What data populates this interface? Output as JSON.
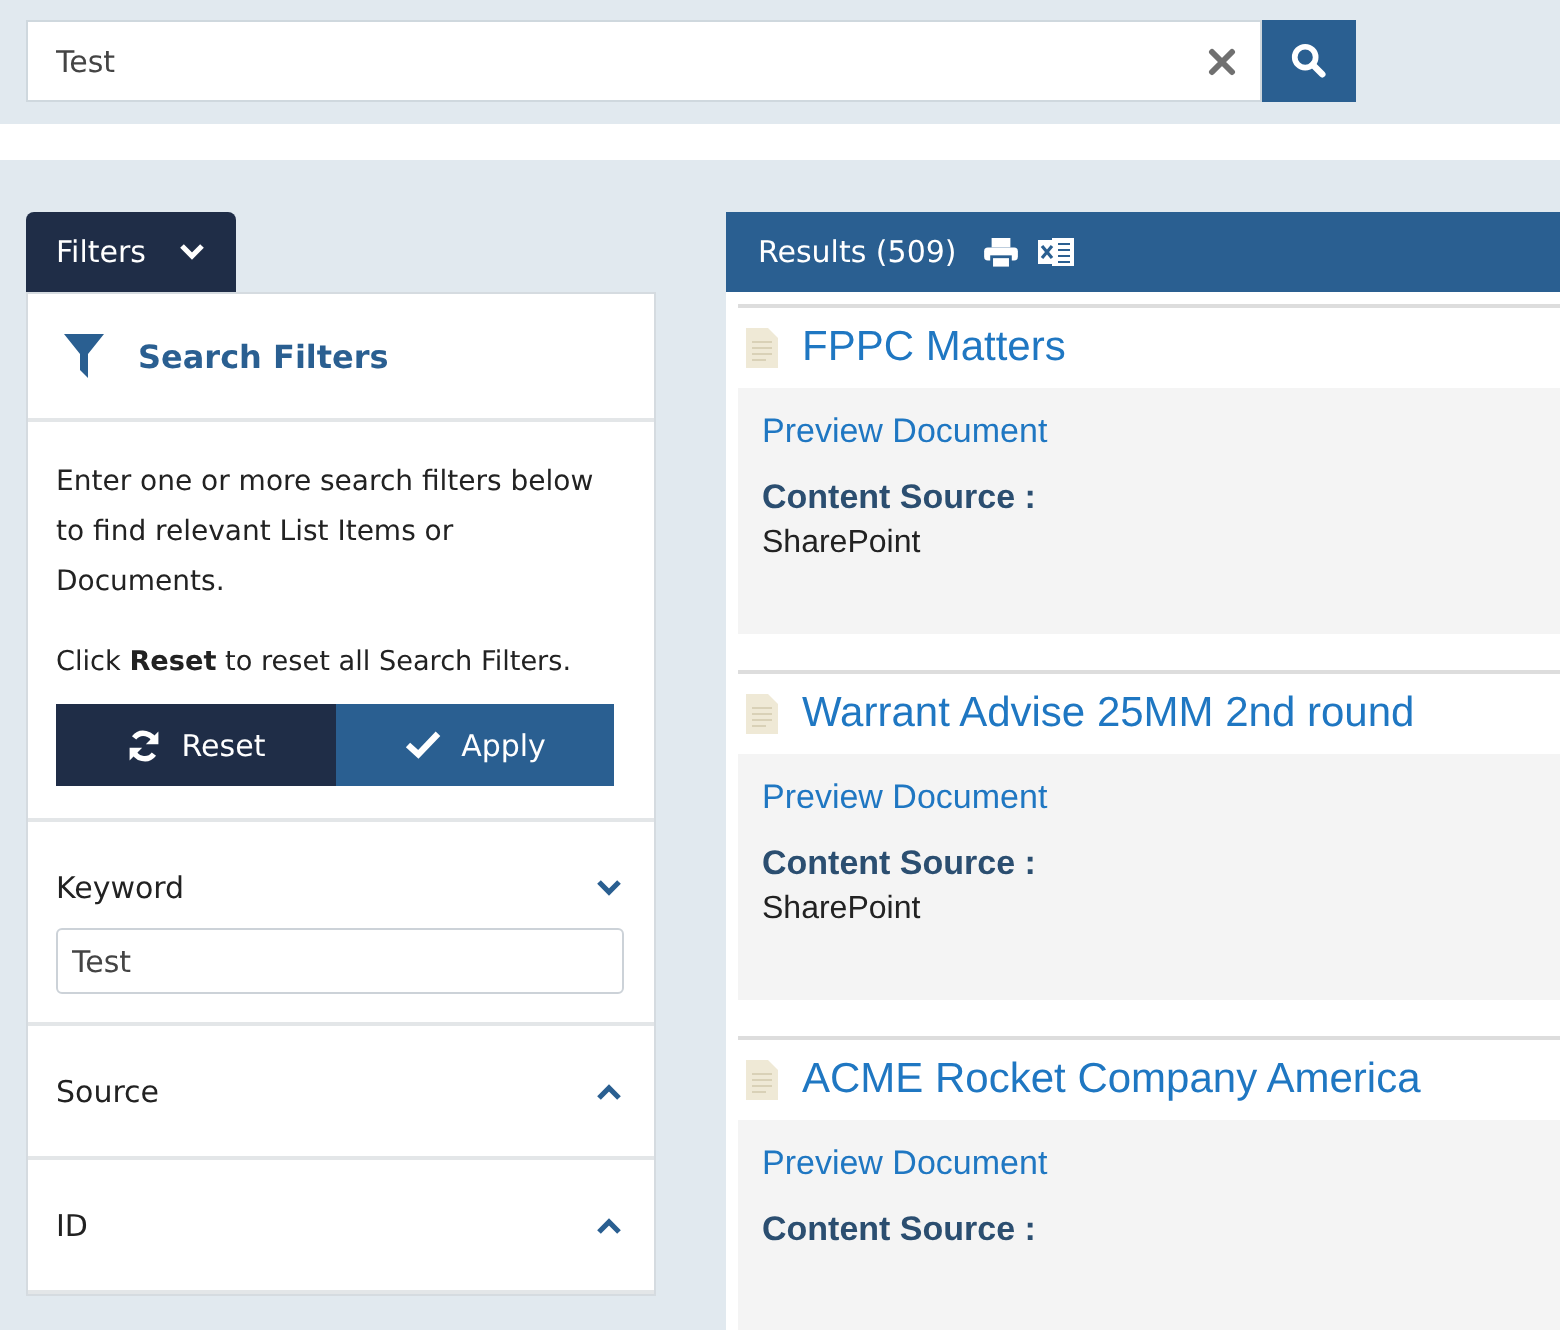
{
  "search": {
    "value": "Test"
  },
  "filters_tab": {
    "label": "Filters"
  },
  "filters_panel": {
    "title": "Search Filters",
    "intro": "Enter one or more search filters below to find relevant List Items or Documents.",
    "hint": "Click **Reset** to reset all Search Filters.",
    "buttons": [
      {
        "kind": "reset",
        "label": "Reset"
      },
      {
        "kind": "apply",
        "label": "Apply"
      }
    ],
    "sections": [
      {
        "label": "Keyword",
        "expanded": true,
        "value": "Test"
      },
      {
        "label": "Source",
        "expanded": false
      },
      {
        "label": "ID",
        "expanded": false
      }
    ]
  },
  "results": {
    "title": "Results (509)",
    "items": [
      {
        "title": "FPPC Matters",
        "link": "Preview Document",
        "field_label": "Content Source :",
        "field_value": "SharePoint"
      },
      {
        "title": "Warrant Advise 25MM 2nd round",
        "link": "Preview Document",
        "field_label": "Content Source :",
        "field_value": "SharePoint"
      },
      {
        "title": "ACME Rocket Company America",
        "link": "Preview Document",
        "field_label": "Content Source :"
      }
    ]
  }
}
